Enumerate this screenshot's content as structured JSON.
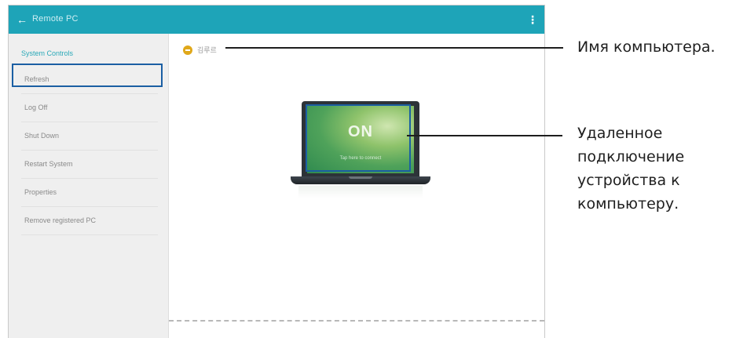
{
  "app": {
    "back_icon": "arrow-left-icon",
    "title": "Remote PC",
    "more_icon": "more-vertical-icon",
    "accent_color": "#1ea4b8"
  },
  "sidebar": {
    "section_title": "System Controls",
    "items": [
      {
        "label": "Refresh"
      },
      {
        "label": "Log Off"
      },
      {
        "label": "Shut Down"
      },
      {
        "label": "Restart System"
      },
      {
        "label": "Properties"
      },
      {
        "label": "Remove registered PC"
      }
    ]
  },
  "main": {
    "pc_name": "김루르",
    "status_icon": "pc-status-icon",
    "status_color": "#e0a81a",
    "laptop_on_label": "ON",
    "laptop_tap_label": "Tap here to connect"
  },
  "annotations": {
    "pc_name": "Имя компьютера.",
    "remote_connect": "Удаленное подключение устройства к компьютеру."
  }
}
